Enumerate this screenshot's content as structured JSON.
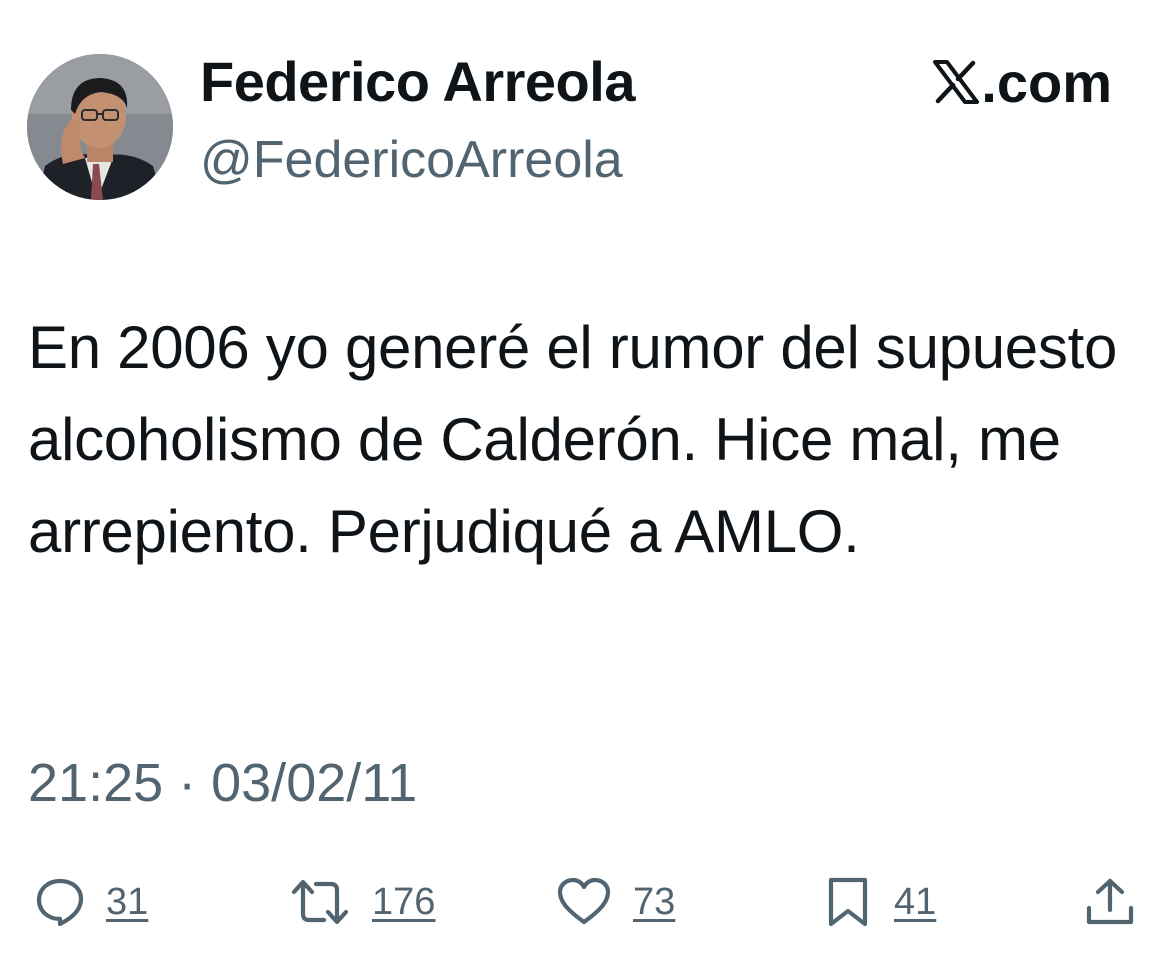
{
  "author": {
    "display_name": "Federico Arreola",
    "handle": "@FedericoArreola",
    "avatar_icon": "profile-photo"
  },
  "source": {
    "logo_icon": "x-logo-icon",
    "label": ".com"
  },
  "tweet": {
    "text": "En 2006 yo generé el rumor del supuesto alcoholismo de Calderón. Hice mal, me arrepiento. Perjudiqué a AMLO.",
    "timestamp": "21:25 · 03/02/11"
  },
  "actions": {
    "reply": {
      "icon": "reply-icon",
      "count": "31"
    },
    "retweet": {
      "icon": "retweet-icon",
      "count": "176"
    },
    "like": {
      "icon": "heart-icon",
      "count": "73"
    },
    "bookmark": {
      "icon": "bookmark-icon",
      "count": "41"
    },
    "share": {
      "icon": "share-icon"
    }
  },
  "colors": {
    "text_primary": "#0f1419",
    "text_secondary": "#536471",
    "background": "#ffffff"
  }
}
